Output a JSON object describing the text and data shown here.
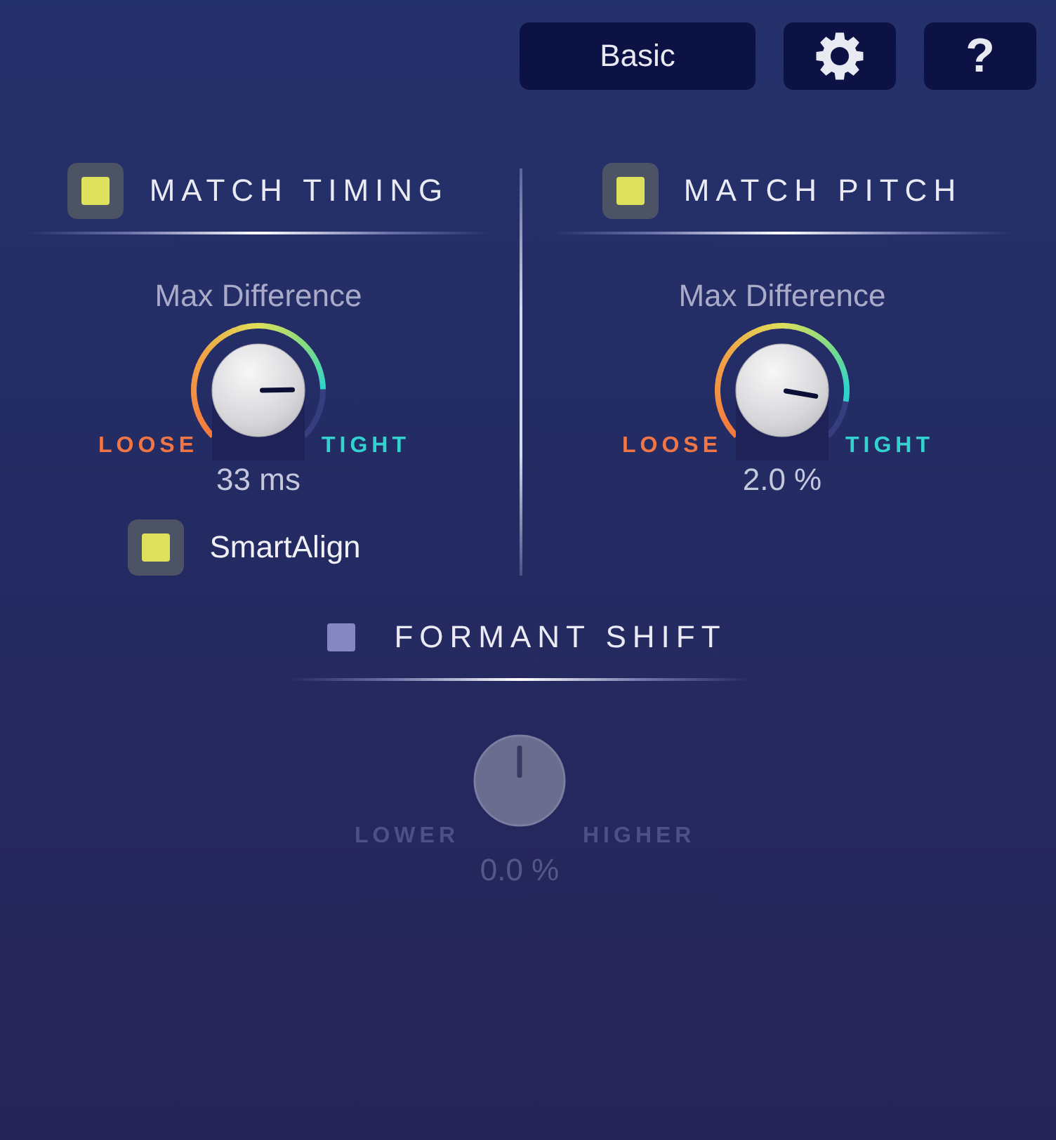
{
  "toolbar": {
    "mode_button": {
      "label": "Basic"
    },
    "help_button": {
      "label": "?"
    }
  },
  "sections": [
    {
      "title": "MATCH TIMING",
      "checked": true,
      "knob": {
        "label": "Max Difference",
        "min_label": "LOOSE",
        "max_label": "TIGHT",
        "reading": "33 ms",
        "level": 0.83,
        "disabled": false
      },
      "options": [
        {
          "label": "SmartAlign",
          "checked": true
        }
      ]
    },
    {
      "title": "MATCH PITCH",
      "checked": true,
      "knob": {
        "label": "Max Difference",
        "min_label": "LOOSE",
        "max_label": "TIGHT",
        "reading": "2.0 %",
        "level": 0.87,
        "disabled": false
      }
    },
    {
      "title": "FORMANT SHIFT",
      "checked": false,
      "knob": {
        "min_label": "LOWER",
        "max_label": "HIGHER",
        "reading": "0.0 %",
        "level": 0.5,
        "disabled": true
      }
    }
  ]
}
